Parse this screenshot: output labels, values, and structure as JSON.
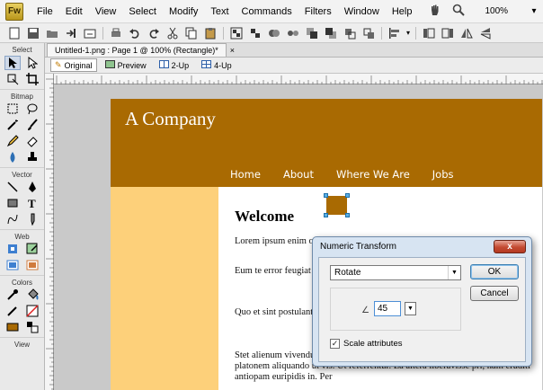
{
  "app": {
    "logo_text": "Fw",
    "menu": [
      "File",
      "Edit",
      "View",
      "Select",
      "Modify",
      "Text",
      "Commands",
      "Filters",
      "Window",
      "Help"
    ],
    "zoom": "100%"
  },
  "document": {
    "tab_title": "Untitled-1.png : Page 1 @ 100% (Rectangle)*",
    "view_tabs": [
      "Original",
      "Preview",
      "2-Up",
      "4-Up"
    ]
  },
  "tools": {
    "sections": [
      "Select",
      "Bitmap",
      "Vector",
      "Web",
      "Colors",
      "View"
    ],
    "stroke_color": "#333333",
    "fill_color": "#a96a02"
  },
  "canvas_page": {
    "company": "A Company",
    "nav": [
      "Home",
      "About",
      "Where We Are",
      "Jobs"
    ],
    "header_color": "#a96a02",
    "sidebar_color": "#fdd07a",
    "heading": "Welcome",
    "paragraphs": [
      "Lorem ipsum enim o                                                   assueverit inciderit,",
      "Eum te error feugiat                                                  an. In solet conclusat                                                  imperdiet ex vis, vel",
      "Quo et sint postulant,                                                  vivendum pri. Mea pe                                                   urbanitas vis ad, quot",
      "Stet alienum vivendu                                                   meis nemore eirmod. Tincidunt constituto nec no, pro platonem aliquando ut vis. Ut referrentur. Ea altera liberavisse pri, nam eruditi antiopam euripidis in. Per"
    ]
  },
  "dialog": {
    "title": "Numeric Transform",
    "close_glyph": "x",
    "transform_type": "Rotate",
    "angle_symbol": "∠",
    "angle_value": "45",
    "scale_attributes_label": "Scale attributes",
    "scale_attributes_checked": true,
    "ok_label": "OK",
    "cancel_label": "Cancel"
  }
}
